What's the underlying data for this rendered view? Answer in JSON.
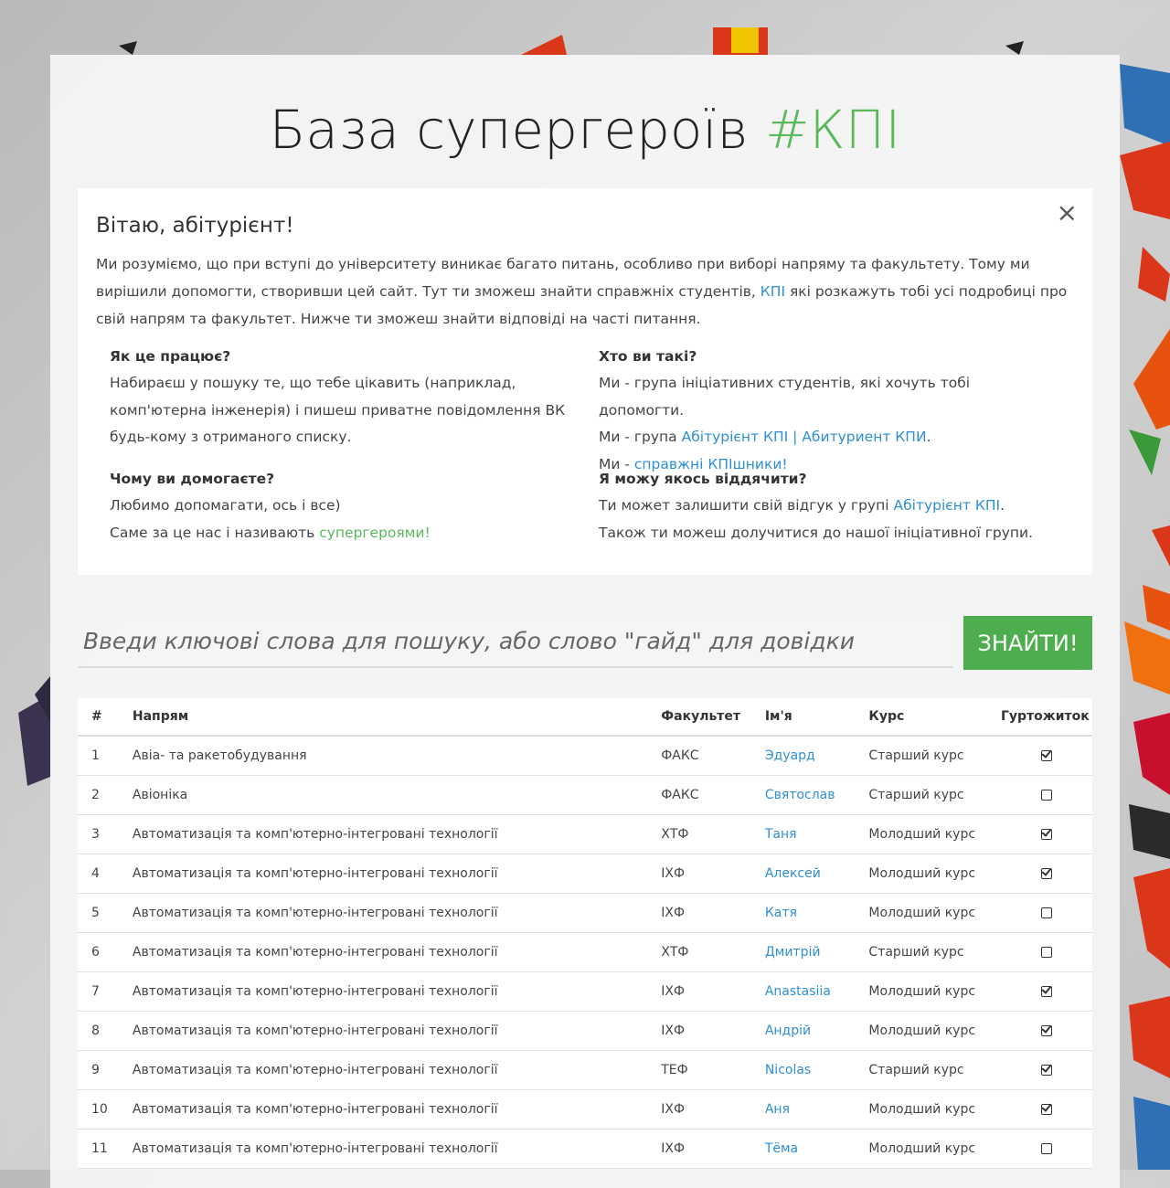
{
  "title": {
    "main": "База супергероїв",
    "tag": "#КПІ"
  },
  "alert": {
    "heading": "Вітаю, абітурієнт!",
    "intro_part1": "Ми розуміємо, що при вступі до університету виникає багато питань, особливо при виборі напряму та факультету. Тому ми вирішили допомогти, створивши цей сайт. Тут ти зможеш знайти справжніх студентів, ",
    "intro_link": "КПІ",
    "intro_part2": " які розкажуть тобі усі подробиці про свій напрям та факультет. Нижче ти зможеш знайти відповіді на часті питання.",
    "close_label": "×"
  },
  "faq": {
    "how": {
      "question": "Як це працює?",
      "answer": "Набираєш у пошуку те, що тебе цікавить (наприклад, комп'ютерна інженерія) і пишеш приватне повідомлення ВК будь-кому з отриманого списку."
    },
    "who": {
      "question": "Хто ви такі?",
      "line1": "Ми - група ініціативних студентів, які хочуть тобі допомогти.",
      "line2_prefix": "Ми - група ",
      "line2_link": "Абітурієнт КПІ | Абитуриент КПИ",
      "line2_suffix": ".",
      "line3_prefix": "Ми - ",
      "line3_link": "справжні КПІшники!"
    },
    "why": {
      "question": "Чому ви домогаєте?",
      "line1": "Любимо допомагати, ось і все)",
      "line2_prefix": "Саме за це нас і називають ",
      "line2_link": "супергероями!"
    },
    "thanks": {
      "question": "Я можу якось віддячити?",
      "line1_prefix": "Ти может залишити свій відгук у групі ",
      "line1_link": "Абітурієнт КПІ",
      "line1_suffix": ".",
      "line2": "Також ти можеш долучитися до нашої ініціативної групи."
    }
  },
  "search": {
    "placeholder": "Введи ключові слова для пошуку, або слово \"гайд\" для довідки",
    "value": "",
    "button_label": "ЗНАЙТИ!"
  },
  "table": {
    "headers": {
      "num": "#",
      "direction": "Напрям",
      "faculty": "Факультет",
      "name": "Ім'я",
      "course": "Курс",
      "dorm": "Гуртожиток"
    },
    "rows": [
      {
        "num": "1",
        "direction": "Авіа- та ракетобудування",
        "faculty": "ФАКС",
        "name": "Эдуард",
        "course": "Старший курс",
        "dorm": true
      },
      {
        "num": "2",
        "direction": "Авіоніка",
        "faculty": "ФАКС",
        "name": "Святослав",
        "course": "Старший курс",
        "dorm": false
      },
      {
        "num": "3",
        "direction": "Автоматизація та комп'ютерно-інтегровані технології",
        "faculty": "ХТФ",
        "name": "Таня",
        "course": "Молодший курс",
        "dorm": true
      },
      {
        "num": "4",
        "direction": "Автоматизація та комп'ютерно-інтегровані технології",
        "faculty": "ІХФ",
        "name": "Алексей",
        "course": "Молодший курс",
        "dorm": true
      },
      {
        "num": "5",
        "direction": "Автоматизація та комп'ютерно-інтегровані технології",
        "faculty": "ІХФ",
        "name": "Катя",
        "course": "Молодший курс",
        "dorm": false
      },
      {
        "num": "6",
        "direction": "Автоматизація та комп'ютерно-інтегровані технології",
        "faculty": "ХТФ",
        "name": "Дмитрій",
        "course": "Старший курс",
        "dorm": false
      },
      {
        "num": "7",
        "direction": "Автоматизація та комп'ютерно-інтегровані технології",
        "faculty": "ІХФ",
        "name": "Anastasiia",
        "course": "Молодший курс",
        "dorm": true
      },
      {
        "num": "8",
        "direction": "Автоматизація та комп'ютерно-інтегровані технології",
        "faculty": "ІХФ",
        "name": "Андрій",
        "course": "Молодший курс",
        "dorm": true
      },
      {
        "num": "9",
        "direction": "Автоматизація та комп'ютерно-інтегровані технології",
        "faculty": "ТЕФ",
        "name": "Nicolas",
        "course": "Старший курс",
        "dorm": true
      },
      {
        "num": "10",
        "direction": "Автоматизація та комп'ютерно-інтегровані технології",
        "faculty": "ІХФ",
        "name": "Аня",
        "course": "Молодший курс",
        "dorm": true
      },
      {
        "num": "11",
        "direction": "Автоматизація та комп'ютерно-інтегровані технології",
        "faculty": "ІХФ",
        "name": "Тёма",
        "course": "Молодший курс",
        "dorm": false
      }
    ]
  },
  "icons": {
    "dorm_yes": "checked-square-icon",
    "dorm_no": "empty-square-icon",
    "close": "close-icon"
  },
  "colors": {
    "accent_green": "#5cb85c",
    "link_blue": "#2e8fd6",
    "button_green": "#4cae4c"
  }
}
